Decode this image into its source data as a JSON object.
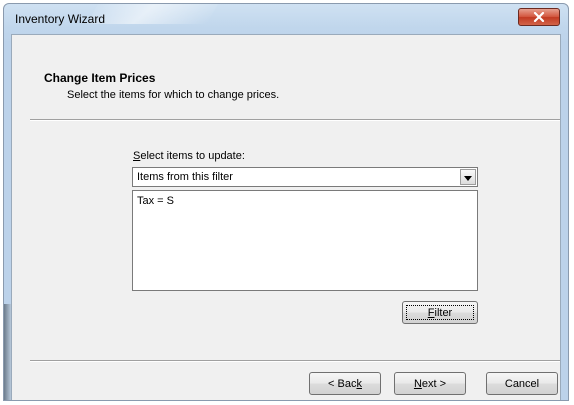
{
  "window": {
    "title": "Inventory Wizard",
    "close_icon": "close-icon"
  },
  "header": {
    "title": "Change Item Prices",
    "subtitle": "Select the items for which to change prices."
  },
  "select_items": {
    "label_accel": "S",
    "label_rest": "elect items to update:",
    "selected_value": "Items from this filter",
    "arrow_icon": "dropdown-arrow-icon"
  },
  "filter_list": {
    "items": [
      "Tax = S"
    ]
  },
  "buttons": {
    "filter_accel": "F",
    "filter_rest": "ilter",
    "back_prefix": "< Bac",
    "back_accel": "k",
    "next_accel": "N",
    "next_rest": "ext >",
    "cancel": "Cancel"
  },
  "colors": {
    "close_red": "#c23a22",
    "window_frame": "#bcd2ea",
    "dialog_bg": "#f0f0f0"
  }
}
